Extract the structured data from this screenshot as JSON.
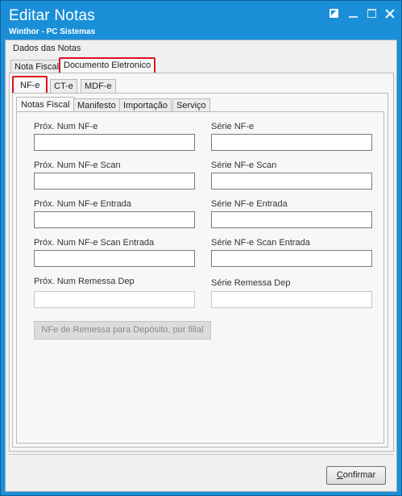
{
  "window": {
    "title": "Editar Notas",
    "subtitle": "Winthor - PC Sistemas",
    "title_bar_color": "#1a8fd8"
  },
  "group": {
    "label": "Dados das Notas"
  },
  "outer_tabs": [
    {
      "label": "Nota Fiscal",
      "active": false
    },
    {
      "label": "Documento Eletronico",
      "active": true,
      "highlighted": true
    }
  ],
  "doc_tabs": [
    {
      "label": "NF-e",
      "active": true,
      "highlighted": true
    },
    {
      "label": "CT-e",
      "active": false
    },
    {
      "label": "MDF-e",
      "active": false
    }
  ],
  "inner_tabs": [
    {
      "label": "Notas Fiscal",
      "active": true
    },
    {
      "label": "Manifesto",
      "active": false
    },
    {
      "label": "Importação",
      "active": false
    },
    {
      "label": "Serviço",
      "active": false
    }
  ],
  "fields": {
    "left": [
      {
        "label": "Próx. Num NF-e",
        "value": "",
        "enabled": true
      },
      {
        "label": "Próx. Num NF-e Scan",
        "value": "",
        "enabled": true
      },
      {
        "label": "Próx. Num NF-e Entrada",
        "value": "",
        "enabled": true
      },
      {
        "label": "Próx. Num NF-e Scan Entrada",
        "value": "",
        "enabled": true
      },
      {
        "label": "Próx. Num Remessa Dep",
        "value": "",
        "enabled": false
      }
    ],
    "right": [
      {
        "label": "Série NF-e",
        "value": "",
        "enabled": true
      },
      {
        "label": "Série NF-e Scan",
        "value": "",
        "enabled": true
      },
      {
        "label": "Série NF-e Entrada",
        "value": "",
        "enabled": true
      },
      {
        "label": "Série NF-e Scan Entrada",
        "value": "",
        "enabled": true
      },
      {
        "label": "Série Remessa Dep",
        "value": "",
        "enabled": false
      }
    ]
  },
  "deposit_button": {
    "label": "NFe de Remessa para Depósito, por filial",
    "enabled": false
  },
  "confirm_button": {
    "accel": "C",
    "rest": "onfirmar"
  },
  "highlight_color": "#e0101e"
}
